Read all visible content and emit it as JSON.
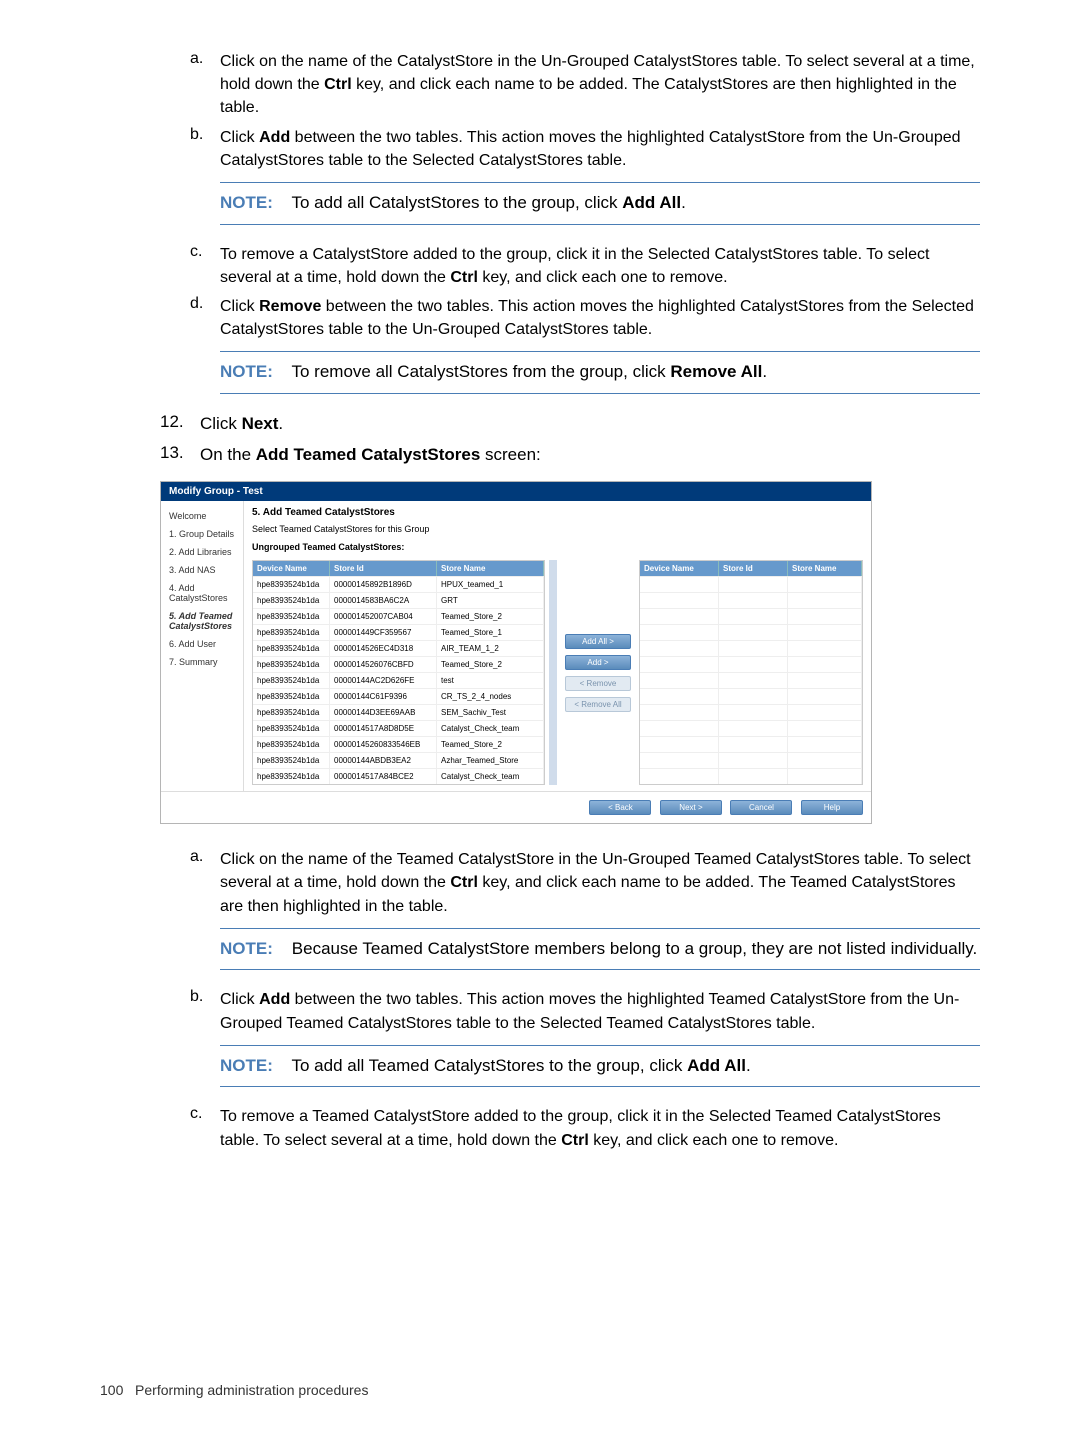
{
  "steps": {
    "a1": {
      "marker": "a.",
      "text_pre": "Click on the name of the CatalystStore in the Un-Grouped CatalystStores table. To select several at a time, hold down the ",
      "ctrl": "Ctrl",
      "text_post": " key, and click each name to be added. The CatalystStores are then highlighted in the table."
    },
    "b1": {
      "marker": "b.",
      "text_pre": "Click ",
      "bold": "Add",
      "text_post": " between the two tables. This action moves the highlighted CatalystStore from the Un-Grouped CatalystStores table to the Selected CatalystStores table."
    },
    "note1": {
      "label": "NOTE:",
      "text_pre": "To add all CatalystStores to the group, click ",
      "bold": "Add All",
      "text_post": "."
    },
    "c1": {
      "marker": "c.",
      "text_pre": "To remove a CatalystStore added to the group, click it in the Selected CatalystStores table. To select several at a time, hold down the ",
      "ctrl": "Ctrl",
      "text_post": " key, and click each one to remove."
    },
    "d1": {
      "marker": "d.",
      "text_pre": "Click ",
      "bold": "Remove",
      "text_post": " between the two tables. This action moves the highlighted CatalystStores from the Selected CatalystStores table to the Un-Grouped CatalystStores table."
    },
    "note2": {
      "label": "NOTE:",
      "text_pre": "To remove all CatalystStores from the group, click ",
      "bold": "Remove All",
      "text_post": "."
    },
    "s12": {
      "marker": "12.",
      "text_pre": "Click ",
      "bold": "Next",
      "text_post": "."
    },
    "s13": {
      "marker": "13.",
      "text_pre": "On the ",
      "bold": "Add Teamed CatalystStores",
      "text_post": " screen:"
    },
    "a2": {
      "marker": "a.",
      "text_pre": "Click on the name of the Teamed CatalystStore in the Un-Grouped Teamed CatalystStores table. To select several at a time, hold down the ",
      "ctrl": "Ctrl",
      "text_post": " key, and click each name to be added. The Teamed CatalystStores are then highlighted in the table."
    },
    "note3": {
      "label": "NOTE:",
      "text": "Because Teamed CatalystStore members belong to a group, they are not listed individually."
    },
    "b2": {
      "marker": "b.",
      "text_pre": "Click ",
      "bold": "Add",
      "text_post": " between the two tables. This action moves the highlighted Teamed CatalystStore from the Un-Grouped Teamed CatalystStores table to the Selected Teamed CatalystStores table."
    },
    "note4": {
      "label": "NOTE:",
      "text_pre": "To add all Teamed CatalystStores to the group, click ",
      "bold": "Add All",
      "text_post": "."
    },
    "c2": {
      "marker": "c.",
      "text_pre": "To remove a Teamed CatalystStore added to the group, click it in the Selected Teamed CatalystStores table. To select several at a time, hold down the ",
      "ctrl": "Ctrl",
      "text_post": " key, and click each one to remove."
    }
  },
  "wizard": {
    "title": "Modify Group - Test",
    "nav": [
      "Welcome",
      "1. Group Details",
      "2. Add Libraries",
      "3. Add NAS",
      "4. Add CatalystStores",
      "5. Add Teamed CatalystStores",
      "6. Add User",
      "7. Summary"
    ],
    "heading": "5. Add Teamed CatalystStores",
    "sub": "Select Teamed CatalystStores for this Group",
    "sub2": "Ungrouped Teamed CatalystStores:",
    "cols": {
      "c1": "Device Name",
      "c2": "Store Id",
      "c3": "Store Name"
    },
    "rows": [
      {
        "c1": "hpe8393524b1da",
        "c2": "00000145892B1896D",
        "c3": "HPUX_teamed_1"
      },
      {
        "c1": "hpe8393524b1da",
        "c2": "0000014583BA6C2A",
        "c3": "GRT"
      },
      {
        "c1": "hpe8393524b1da",
        "c2": "000001452007CAB04",
        "c3": "Teamed_Store_2"
      },
      {
        "c1": "hpe8393524b1da",
        "c2": "000001449CF359567",
        "c3": "Teamed_Store_1"
      },
      {
        "c1": "hpe8393524b1da",
        "c2": "0000014526EC4D318",
        "c3": "AIR_TEAM_1_2"
      },
      {
        "c1": "hpe8393524b1da",
        "c2": "0000014526076CBFD",
        "c3": "Teamed_Store_2"
      },
      {
        "c1": "hpe8393524b1da",
        "c2": "00000144AC2D626FE",
        "c3": "test"
      },
      {
        "c1": "hpe8393524b1da",
        "c2": "00000144C61F9396",
        "c3": "CR_TS_2_4_nodes"
      },
      {
        "c1": "hpe8393524b1da",
        "c2": "00000144D3EE69AAB",
        "c3": "SEM_Sachiv_Test"
      },
      {
        "c1": "hpe8393524b1da",
        "c2": "0000014517A8D8D5E",
        "c3": "Catalyst_Check_team"
      },
      {
        "c1": "hpe8393524b1da",
        "c2": "00000145260833546EB",
        "c3": "Teamed_Store_2"
      },
      {
        "c1": "hpe8393524b1da",
        "c2": "00000144ABDB3EA2",
        "c3": "Azhar_Teamed_Store"
      },
      {
        "c1": "hpe8393524b1da",
        "c2": "0000014517A84BCE2",
        "c3": "Catalyst_Check_team"
      }
    ],
    "right_rows": 13,
    "btns": {
      "addall": "Add All >",
      "add": "Add >",
      "remove": "< Remove",
      "removeall": "< Remove All"
    },
    "foot": {
      "back": "< Back",
      "next": "Next >",
      "cancel": "Cancel",
      "help": "Help"
    }
  },
  "footer": {
    "page": "100",
    "section": "Performing administration procedures"
  }
}
